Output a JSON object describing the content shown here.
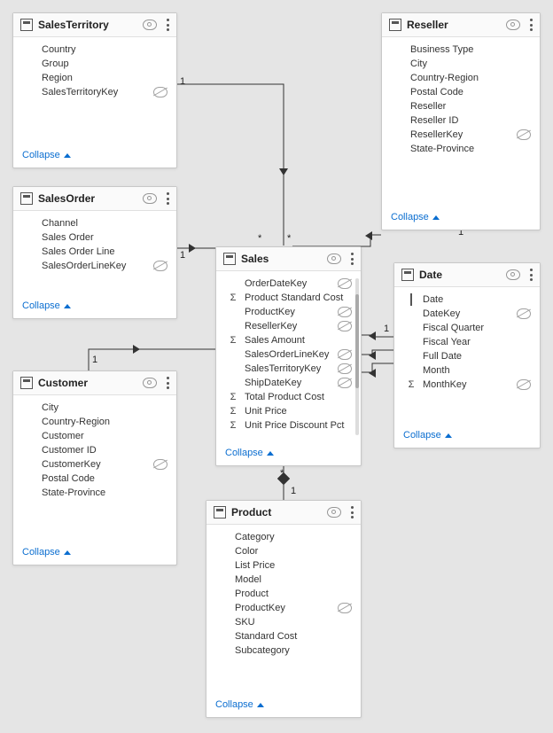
{
  "labels": {
    "collapse": "Collapse"
  },
  "rel_labels": {
    "one": "1",
    "many": "*"
  },
  "tables": {
    "salesTerritory": {
      "name": "SalesTerritory",
      "fields": [
        {
          "kind": "",
          "name": "Country",
          "hidden": false
        },
        {
          "kind": "",
          "name": "Group",
          "hidden": false
        },
        {
          "kind": "",
          "name": "Region",
          "hidden": false
        },
        {
          "kind": "",
          "name": "SalesTerritoryKey",
          "hidden": true
        }
      ]
    },
    "reseller": {
      "name": "Reseller",
      "fields": [
        {
          "kind": "",
          "name": "Business Type",
          "hidden": false
        },
        {
          "kind": "",
          "name": "City",
          "hidden": false
        },
        {
          "kind": "",
          "name": "Country-Region",
          "hidden": false
        },
        {
          "kind": "",
          "name": "Postal Code",
          "hidden": false
        },
        {
          "kind": "",
          "name": "Reseller",
          "hidden": false
        },
        {
          "kind": "",
          "name": "Reseller ID",
          "hidden": false
        },
        {
          "kind": "",
          "name": "ResellerKey",
          "hidden": true
        },
        {
          "kind": "",
          "name": "State-Province",
          "hidden": false
        }
      ]
    },
    "salesOrder": {
      "name": "SalesOrder",
      "fields": [
        {
          "kind": "",
          "name": "Channel",
          "hidden": false
        },
        {
          "kind": "",
          "name": "Sales Order",
          "hidden": false
        },
        {
          "kind": "",
          "name": "Sales Order Line",
          "hidden": false
        },
        {
          "kind": "",
          "name": "SalesOrderLineKey",
          "hidden": true
        }
      ]
    },
    "sales": {
      "name": "Sales",
      "fields": [
        {
          "kind": "",
          "name": "OrderDateKey",
          "hidden": true
        },
        {
          "kind": "Σ",
          "name": "Product Standard Cost",
          "hidden": false
        },
        {
          "kind": "",
          "name": "ProductKey",
          "hidden": true
        },
        {
          "kind": "",
          "name": "ResellerKey",
          "hidden": true
        },
        {
          "kind": "Σ",
          "name": "Sales Amount",
          "hidden": false
        },
        {
          "kind": "",
          "name": "SalesOrderLineKey",
          "hidden": true
        },
        {
          "kind": "",
          "name": "SalesTerritoryKey",
          "hidden": true
        },
        {
          "kind": "",
          "name": "ShipDateKey",
          "hidden": true
        },
        {
          "kind": "Σ",
          "name": "Total Product Cost",
          "hidden": false
        },
        {
          "kind": "Σ",
          "name": "Unit Price",
          "hidden": false
        },
        {
          "kind": "Σ",
          "name": "Unit Price Discount Pct",
          "hidden": false
        }
      ]
    },
    "date": {
      "name": "Date",
      "fields": [
        {
          "kind": "date",
          "name": "Date",
          "hidden": false
        },
        {
          "kind": "",
          "name": "DateKey",
          "hidden": true
        },
        {
          "kind": "",
          "name": "Fiscal Quarter",
          "hidden": false
        },
        {
          "kind": "",
          "name": "Fiscal Year",
          "hidden": false
        },
        {
          "kind": "",
          "name": "Full Date",
          "hidden": false
        },
        {
          "kind": "",
          "name": "Month",
          "hidden": false
        },
        {
          "kind": "Σ",
          "name": "MonthKey",
          "hidden": true
        }
      ]
    },
    "customer": {
      "name": "Customer",
      "fields": [
        {
          "kind": "",
          "name": "City",
          "hidden": false
        },
        {
          "kind": "",
          "name": "Country-Region",
          "hidden": false
        },
        {
          "kind": "",
          "name": "Customer",
          "hidden": false
        },
        {
          "kind": "",
          "name": "Customer ID",
          "hidden": false
        },
        {
          "kind": "",
          "name": "CustomerKey",
          "hidden": true
        },
        {
          "kind": "",
          "name": "Postal Code",
          "hidden": false
        },
        {
          "kind": "",
          "name": "State-Province",
          "hidden": false
        }
      ]
    },
    "product": {
      "name": "Product",
      "fields": [
        {
          "kind": "",
          "name": "Category",
          "hidden": false
        },
        {
          "kind": "",
          "name": "Color",
          "hidden": false
        },
        {
          "kind": "",
          "name": "List Price",
          "hidden": false
        },
        {
          "kind": "",
          "name": "Model",
          "hidden": false
        },
        {
          "kind": "",
          "name": "Product",
          "hidden": false
        },
        {
          "kind": "",
          "name": "ProductKey",
          "hidden": true
        },
        {
          "kind": "",
          "name": "SKU",
          "hidden": false
        },
        {
          "kind": "",
          "name": "Standard Cost",
          "hidden": false
        },
        {
          "kind": "",
          "name": "Subcategory",
          "hidden": false
        }
      ]
    }
  }
}
